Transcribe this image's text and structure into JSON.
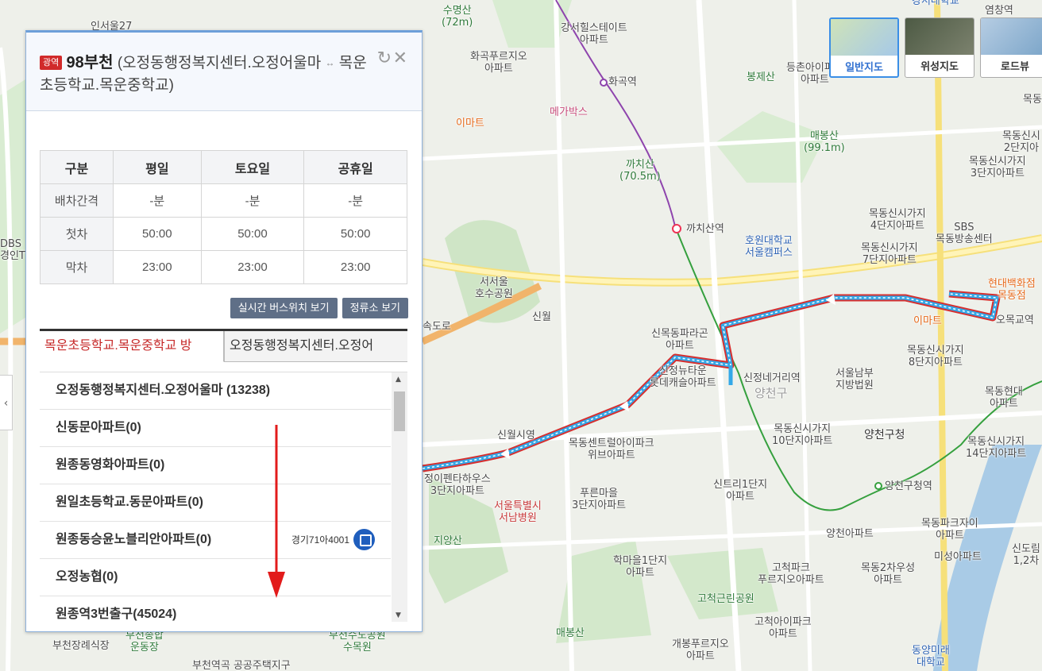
{
  "map": {
    "map_types": [
      {
        "label": "일반지도",
        "active": true
      },
      {
        "label": "위성지도",
        "active": false
      },
      {
        "label": "로드뷰",
        "active": false
      }
    ],
    "labels": {
      "suymyeongsan": "수명산",
      "suymyeongsan_h": "(72m)",
      "gangseo_hill": "강서힐스테이트",
      "gangseo_hill2": "아파트",
      "hwagok_pureuji": "화곡푸르지오",
      "hwagok_pureuji2": "아파트",
      "hwagok_stn": "화곡역",
      "megabox": "메가박스",
      "emart1": "이마트",
      "bongjesan": "봉제산",
      "deungchon": "등촌아이파크",
      "deungchon2": "아파트",
      "maebongsan": "매봉산",
      "maebongsan_h": "(99.1m)",
      "kkachisan": "까치산",
      "kkachisan_h": "(70.5m)",
      "kkachisan_stn": "까치산역",
      "howon": "호원대학교",
      "howon2": "서울캠퍼스",
      "seoseoul": "서서울",
      "seoseoul2": "호수공원",
      "sinwol_ic": "신월",
      "expressway": "속도로",
      "sinmok_paragon": "신목동파라곤",
      "sinmok_paragon2": "아파트",
      "sinjeong_newtown": "신정뉴타운",
      "sinjeong_newtown2": "롯데캐슬아파트",
      "sinjeong_ne_stn": "신정네거리역",
      "yangcheon_gu": "양천구",
      "sinwolsi": "신월시영",
      "mokdong_central": "목동센트럴아이파크",
      "mokdong_central2": "위브아파트",
      "jeongi_penta": "정이펜타하우스",
      "jeongi_penta2": "3단지아파트",
      "seoul_hosp": "서울특별시",
      "seoul_hosp2": "서남병원",
      "pureun": "푸른마을",
      "pureun2": "3단지아파트",
      "jiyangsan": "지양산",
      "sintri": "신트리1단지",
      "sintri2": "아파트",
      "hakmaeul": "학마을1단지",
      "hakmaeul2": "아파트",
      "gocheok_park": "고척근린공원",
      "gocheok_park_apt": "고척파크",
      "gocheok_park_apt2": "푸르지오아파트",
      "maebongsan2": "매봉산",
      "gocheok_ipark": "고척아이파크",
      "gocheok_ipark2": "아파트",
      "gaebong": "개봉푸르지오",
      "gaebong2": "아파트",
      "bucheon_jang": "부천장례식장",
      "bucheon_stadium": "부천종합",
      "bucheon_stadium2": "운동장",
      "bucheon_water": "부천수도공원",
      "bucheon_water2": "수목원",
      "bucheon_public": "부천역곡 공공주택지구",
      "mokdong4": "목동신시가지",
      "mokdong4b": "4단지아파트",
      "mokdong7": "목동신시가지",
      "mokdong7b": "7단지아파트",
      "mokdong3": "목동신시가지",
      "mokdong3b": "3단지아파트",
      "mokdong2": "목동신시",
      "mokdong2b": "2단지아",
      "sbs": "SBS",
      "sbs2": "목동방송센터",
      "hyundai": "현대백화점",
      "hyundai2": "목동점",
      "emart2": "이마트",
      "omokgyo": "오목교역",
      "mokdong8": "목동신시가지",
      "mokdong8b": "8단지아파트",
      "seoul_court": "서울남부",
      "seoul_court2": "지방법원",
      "mokdong_hyundai": "목동현대",
      "mokdong_hyundai2": "아파트",
      "yangcheon_office": "양천구청",
      "mokdong10": "목동신시가지",
      "mokdong10b": "10단지아파트",
      "mokdong14": "목동신시가지",
      "mokdong14b": "14단지아파트",
      "yangcheon_stn": "양천구청역",
      "yangcheon_apt": "양천아파트",
      "mokdong_park": "목동파크자이",
      "mokdong_park2": "아파트",
      "misung": "미성아파트",
      "mokdong2cha": "목동2차우성",
      "mokdong2cha2": "아파트",
      "sindorim": "신도림",
      "sindorim2": "1,2차",
      "dongyang": "동양미래",
      "dongyang2": "대학교",
      "gangseo_univ": "강서대학교",
      "yeomchang": "염창역",
      "mokdong_right": "목동",
      "left_insu": "인서울27",
      "left_sbs": "DBS",
      "left_sbs2": "경인TV"
    }
  },
  "panel": {
    "badge": "광역",
    "route_name": "98부천",
    "route_desc": "(오정동행정복지센터.오정어울마",
    "arrow": "↔",
    "route_dest": "목운초등학교.목운중학교)",
    "schedule": {
      "headers": [
        "구분",
        "평일",
        "토요일",
        "공휴일"
      ],
      "rows": [
        {
          "label": "배차간격",
          "values": [
            "-분",
            "-분",
            "-분"
          ]
        },
        {
          "label": "첫차",
          "values": [
            "50:00",
            "50:00",
            "50:00"
          ]
        },
        {
          "label": "막차",
          "values": [
            "23:00",
            "23:00",
            "23:00"
          ]
        }
      ]
    },
    "buttons": {
      "realtime": "실시간 버스위치 보기",
      "stops": "정류소 보기"
    },
    "tabs": [
      {
        "label": "목운초등학교.목운중학교 방",
        "active": true
      },
      {
        "label": "오정동행정복지센터.오정어",
        "active": false
      }
    ],
    "stops": [
      {
        "name": "오정동행정복지센터.오정어울마 (13238)"
      },
      {
        "name": "신동문아파트(0)"
      },
      {
        "name": "원종동영화아파트(0)"
      },
      {
        "name": "원일초등학교.동문아파트(0)"
      },
      {
        "name": "원종동승윤노블리안아파트(0)",
        "bus_plate": "경기71아4001"
      },
      {
        "name": "오정농협(0)"
      },
      {
        "name": "원종역3번출구(45024)"
      }
    ]
  }
}
